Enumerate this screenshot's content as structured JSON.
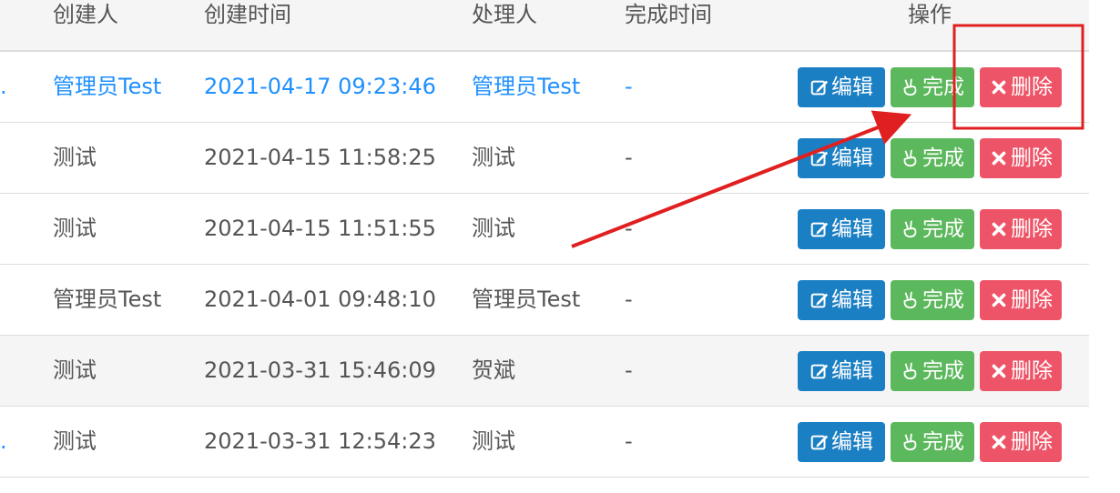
{
  "header": {
    "creator": "创建人",
    "created_time": "创建时间",
    "handler": "处理人",
    "done_time": "完成时间",
    "actions": "操作"
  },
  "buttons": {
    "edit": "编辑",
    "done": "完成",
    "delete": "删除"
  },
  "rows": [
    {
      "dot": ".",
      "creator": "管理员Test",
      "created_time": "2021-04-17 09:23:46",
      "handler": "管理员Test",
      "done_time": "-"
    },
    {
      "dot": "",
      "creator": "测试",
      "created_time": "2021-04-15 11:58:25",
      "handler": "测试",
      "done_time": "-"
    },
    {
      "dot": "",
      "creator": "测试",
      "created_time": "2021-04-15 11:51:55",
      "handler": "测试",
      "done_time": "-"
    },
    {
      "dot": "",
      "creator": "管理员Test",
      "created_time": "2021-04-01 09:48:10",
      "handler": "管理员Test",
      "done_time": "-"
    },
    {
      "dot": "",
      "creator": "测试",
      "created_time": "2021-03-31 15:46:09",
      "handler": "贺斌",
      "done_time": "-"
    },
    {
      "dot": ".",
      "creator": "测试",
      "created_time": "2021-03-31 12:54:23",
      "handler": "测试",
      "done_time": "-"
    }
  ],
  "colors": {
    "edit": "#1b7fc4",
    "done": "#5cb85c",
    "delete": "#ee5467",
    "link": "#1e90ff",
    "annotation": "#e02020"
  }
}
